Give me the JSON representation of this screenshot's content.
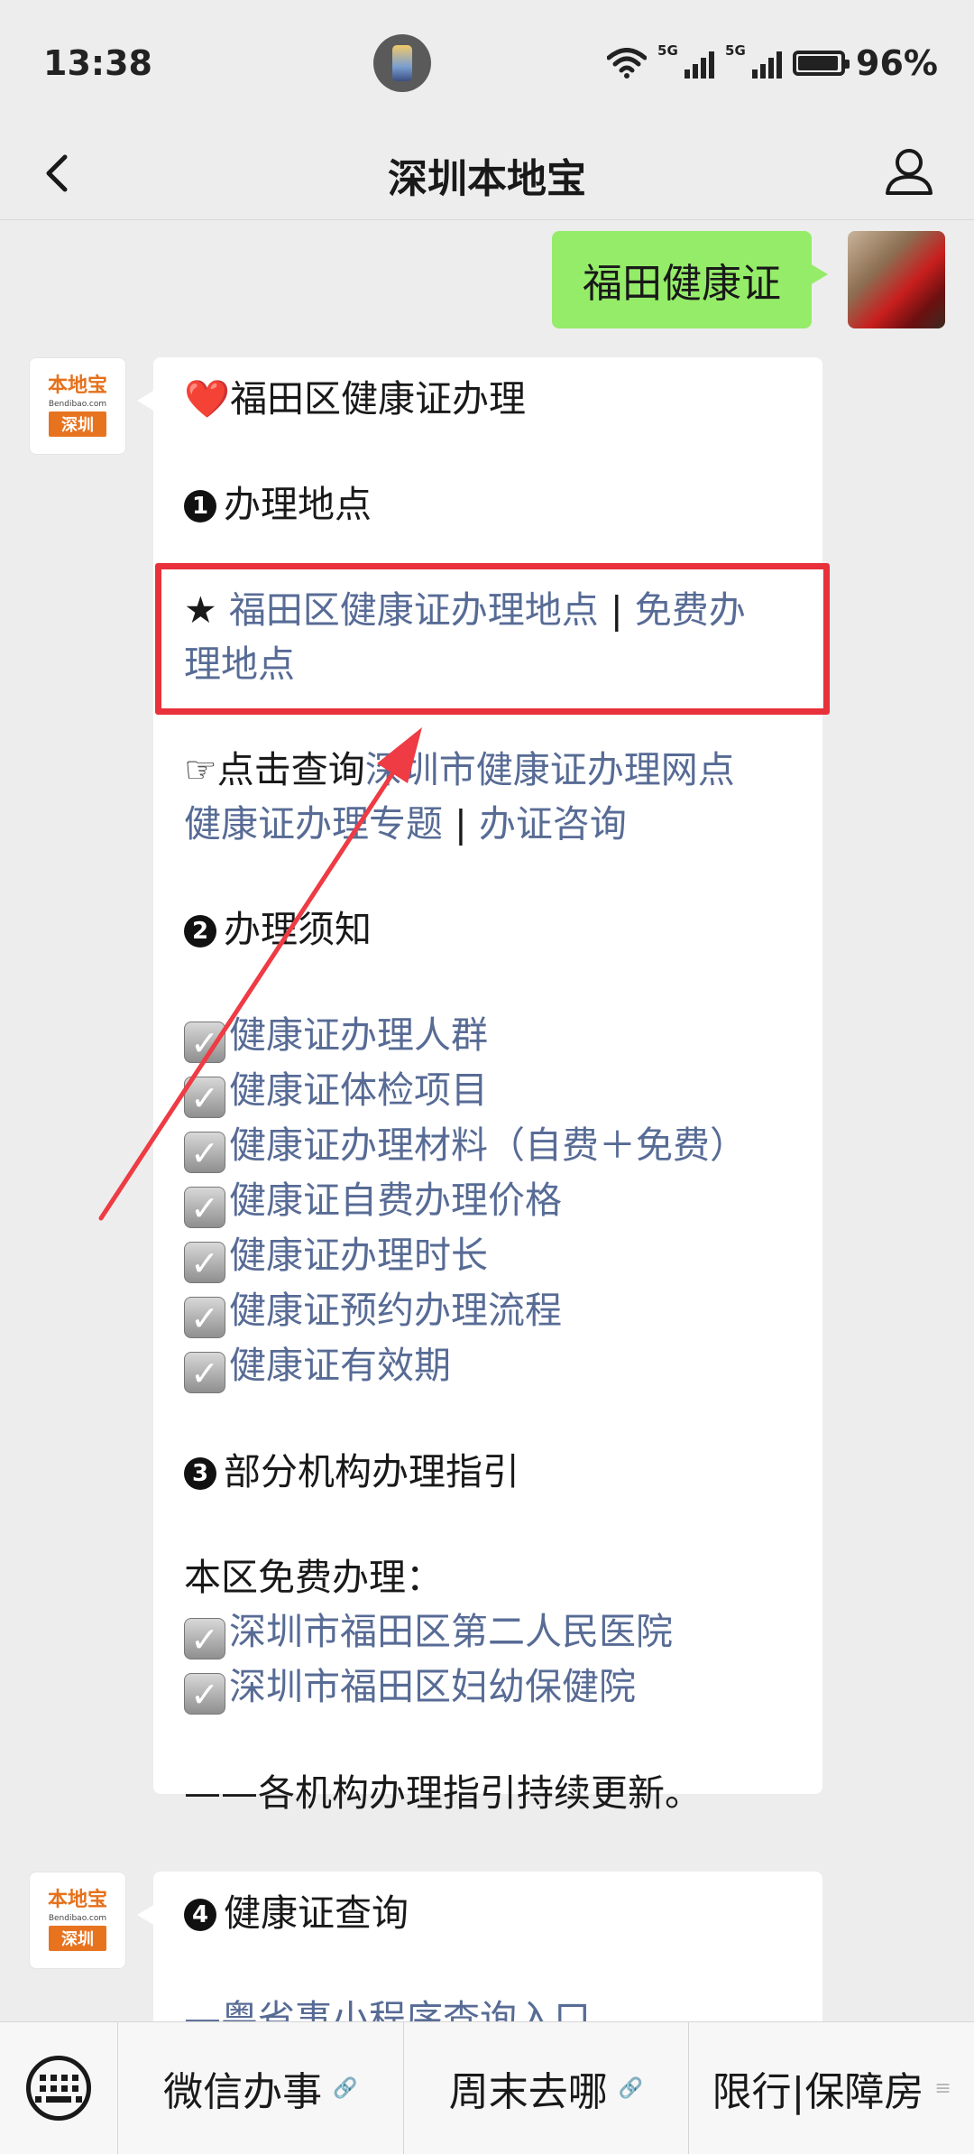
{
  "status_bar": {
    "time": "13:38",
    "network1": "5G",
    "network2": "5G",
    "battery": "96%"
  },
  "nav": {
    "title": "深圳本地宝"
  },
  "chat": {
    "outgoing_message": "福田健康证",
    "bot_avatar": {
      "top": "本地宝",
      "middle": "Bendibao.com",
      "bottom": "深圳"
    },
    "message1": {
      "title_icon": "❤️",
      "title": "福田区健康证办理",
      "section1_num": "1",
      "section1_title": "办理地点",
      "star": "★",
      "location_link_a": "福田区健康证办理地点",
      "location_sep": "|",
      "location_link_b": "免费办",
      "location_link_b_cont": "理地点",
      "hand_icon": "☞",
      "click_query": "点击查询",
      "link_outlets": "深圳市健康证办理网点",
      "link_topic": "健康证办理专题",
      "topic_sep": "|",
      "link_consult": "办证咨询",
      "section2_num": "2",
      "section2_title": "办理须知",
      "checklist": [
        "健康证办理人群",
        "健康证体检项目",
        "健康证办理材料（自费＋免费）",
        "健康证自费办理价格",
        "健康证办理时长",
        "健康证预约办理流程",
        "健康证有效期"
      ],
      "section3_num": "3",
      "section3_title": "部分机构办理指引",
      "free_label": "本区免费办理：",
      "institutions": [
        "深圳市福田区第二人民医院",
        "深圳市福田区妇幼保健院"
      ],
      "footer": "——各机构办理指引持续更新。"
    },
    "message2": {
      "section4_num": "4",
      "section4_title": "健康证查询",
      "partial_line": "—粤省事小程序查询入口"
    }
  },
  "bottom_menu": {
    "items": [
      "微信办事",
      "周末去哪",
      "限行|保障房"
    ]
  },
  "colors": {
    "background": "#ededed",
    "outgoing_bubble": "#95ec69",
    "link": "#576b95",
    "highlight": "#e8313a",
    "brand_orange": "#e8731f"
  }
}
